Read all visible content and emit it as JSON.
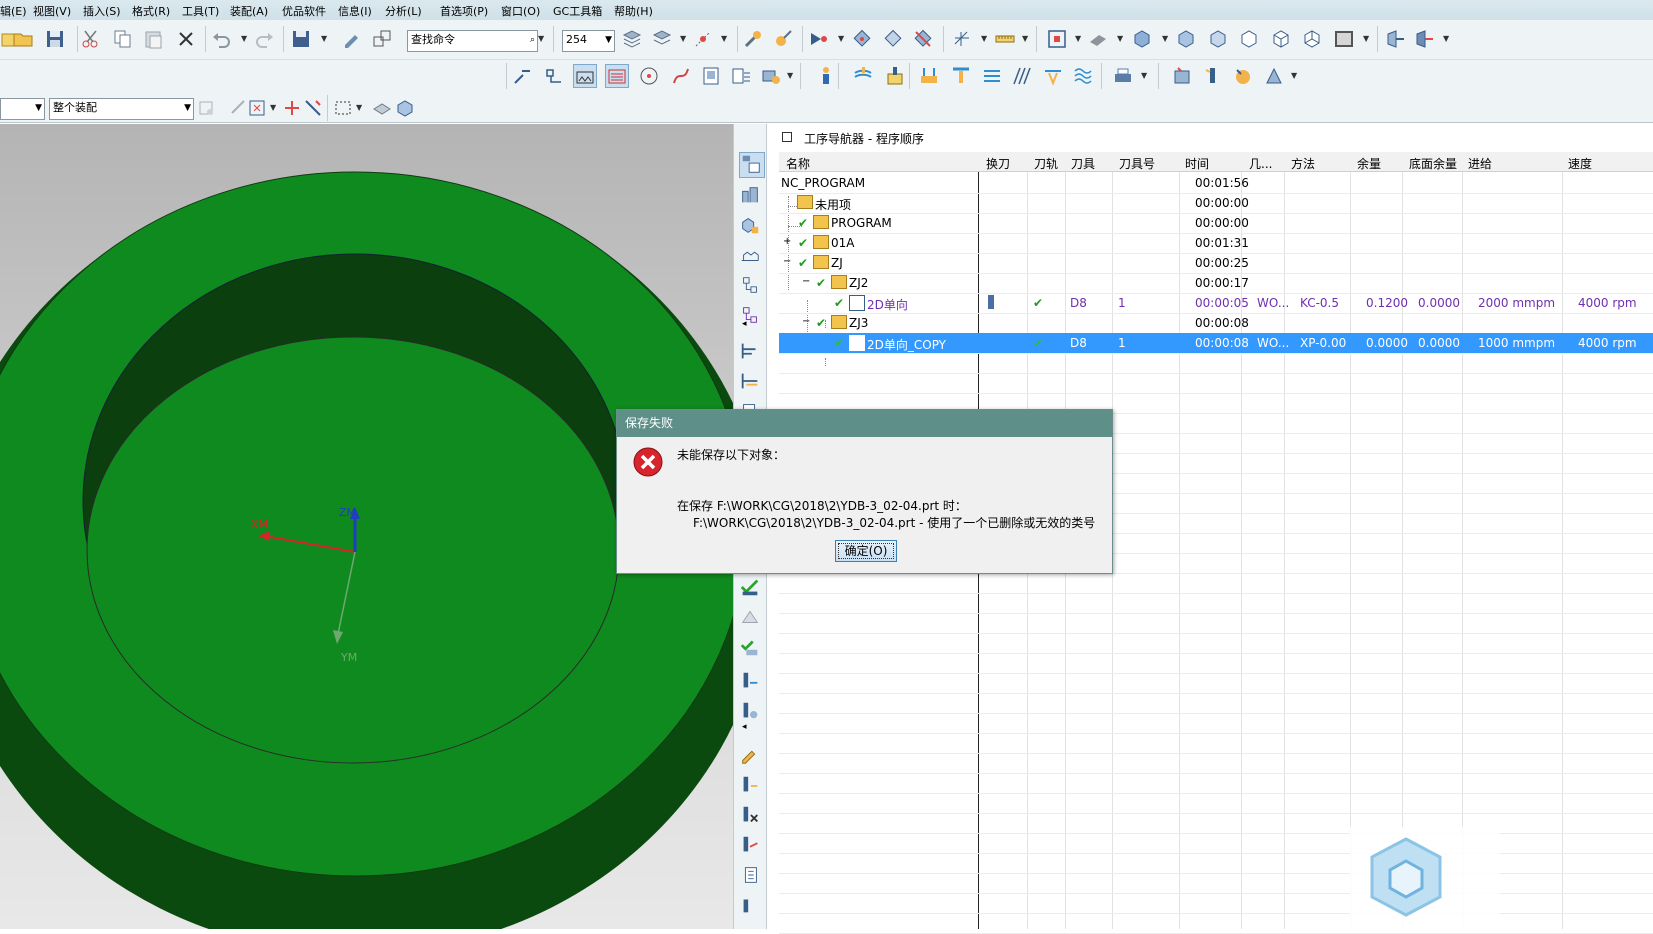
{
  "menu": [
    "辑(E)",
    "视图(V)",
    "插入(S)",
    "格式(R)",
    "工具(T)",
    "装配(A)",
    "优品软件",
    "信息(I)",
    "分析(L)",
    "首选项(P)",
    "窗口(O)",
    "GC工具箱",
    "帮助(H)"
  ],
  "toolbar": {
    "command_search_placeholder": "查找命令",
    "layer_value": "254",
    "filter_value": "",
    "assembly_scope": "整个装配"
  },
  "viewport": {
    "axis_x": "XM",
    "axis_y": "YM",
    "axis_z": "ZM",
    "part_color": "#0f8a1f"
  },
  "navigator": {
    "title": "工序导航器 - 程序顺序",
    "columns": [
      "名称",
      "换刀",
      "刀轨",
      "刀具",
      "刀具号",
      "时间",
      "几...",
      "方法",
      "余量",
      "底面余量",
      "进给",
      "速度"
    ],
    "rows": [
      {
        "name": "NC_PROGRAM",
        "time": "00:01:56"
      },
      {
        "name": "未用项",
        "time": "00:00:00"
      },
      {
        "name": "PROGRAM",
        "time": "00:00:00"
      },
      {
        "name": "01A",
        "time": "00:01:31"
      },
      {
        "name": "ZJ",
        "time": "00:00:25"
      },
      {
        "name": "ZJ2",
        "time": "00:00:17"
      },
      {
        "name": "2D单向",
        "time": "00:00:05",
        "tool": "D8",
        "tool_no": "1",
        "geom": "WO...",
        "method": "KC-0.5",
        "stock": "0.1200",
        "floor_stock": "0.0000",
        "feed": "2000 mmpm",
        "speed": "4000 rpm"
      },
      {
        "name": "ZJ3",
        "time": "00:00:08"
      },
      {
        "name": "2D单向_COPY",
        "time": "00:00:08",
        "tool": "D8",
        "tool_no": "1",
        "geom": "WO...",
        "method": "XP-0.00",
        "stock": "0.0000",
        "floor_stock": "0.0000",
        "feed": "1000 mmpm",
        "speed": "4000 rpm"
      }
    ]
  },
  "dialog": {
    "title": "保存失败",
    "message": "未能保存以下对象：",
    "detail_line1": "在保存 F:\\WORK\\CG\\2018\\2\\YDB-3_02-04.prt 时：",
    "detail_line2": "F:\\WORK\\CG\\2018\\2\\YDB-3_02-04.prt -  使用了一个已删除或无效的类号",
    "ok_label": "确定(O)"
  }
}
